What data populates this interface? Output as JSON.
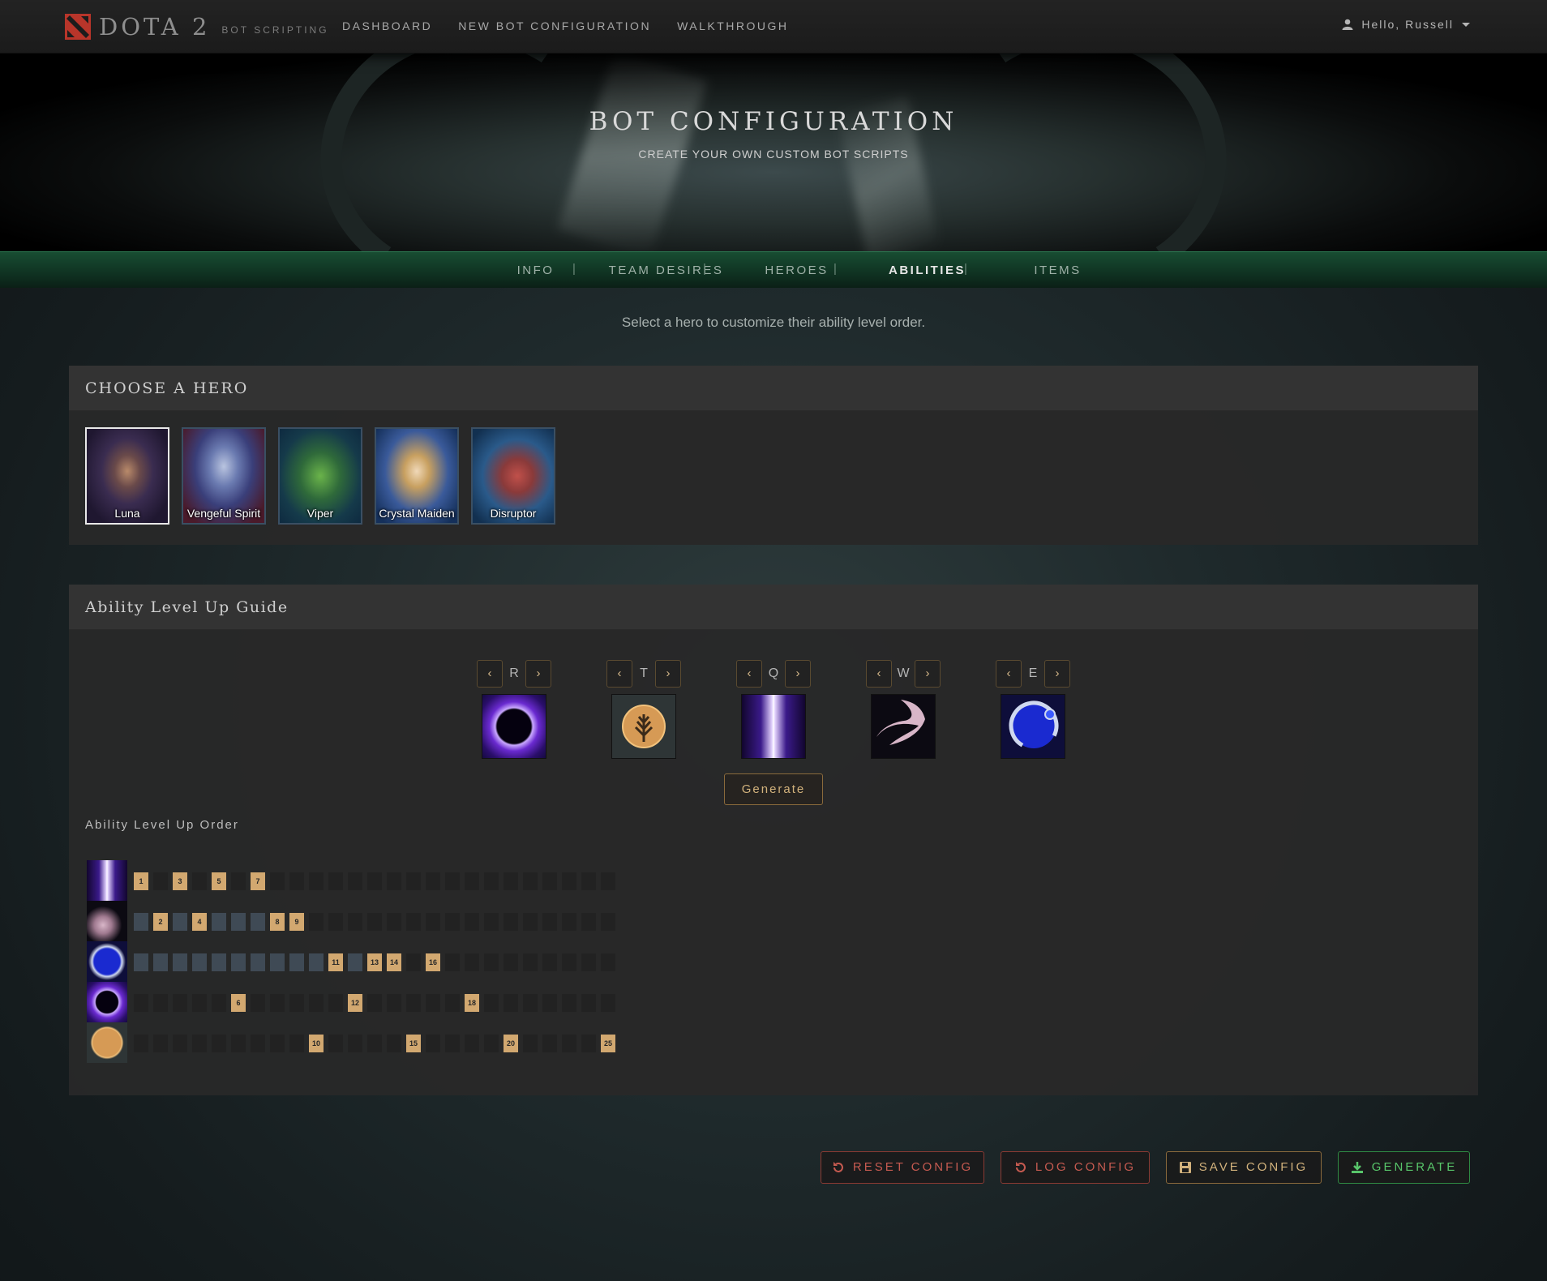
{
  "nav": {
    "logo_title": "DOTA 2",
    "logo_sub": "BOT SCRIPTING",
    "links": [
      "DASHBOARD",
      "NEW BOT CONFIGURATION",
      "WALKTHROUGH"
    ],
    "user": "Hello, Russell"
  },
  "banner": {
    "title": "BOT CONFIGURATION",
    "subtitle": "CREATE YOUR OWN CUSTOM BOT SCRIPTS"
  },
  "tabs": [
    "INFO",
    "TEAM DESIRES",
    "HEROES",
    "ABILITIES",
    "ITEMS"
  ],
  "active_tab": "ABILITIES",
  "intro": "Select a hero to customize their ability level order.",
  "hero_panel": {
    "title": "CHOOSE A HERO",
    "heroes": [
      {
        "name": "Luna",
        "selected": true
      },
      {
        "name": "Vengeful Spirit",
        "selected": false
      },
      {
        "name": "Viper",
        "selected": false
      },
      {
        "name": "Crystal Maiden",
        "selected": false
      },
      {
        "name": "Disruptor",
        "selected": false
      }
    ]
  },
  "ability_panel": {
    "title": "Ability Level Up Guide",
    "priority": [
      {
        "key": "R",
        "icon": "eclipse-icon"
      },
      {
        "key": "T",
        "icon": "talent-tree-icon"
      },
      {
        "key": "Q",
        "icon": "lucent-beam-icon"
      },
      {
        "key": "W",
        "icon": "moon-glaive-icon"
      },
      {
        "key": "E",
        "icon": "lunar-blessing-icon"
      }
    ],
    "generate_label": "Generate",
    "order_title": "Ability Level Up Order",
    "order_rows": [
      {
        "icon": "lucent-beam-icon",
        "levels": [
          1,
          3,
          5,
          7
        ],
        "filled_upto": 0
      },
      {
        "icon": "moon-glaive-icon",
        "levels": [
          2,
          4,
          8,
          9
        ],
        "filled_upto": 7
      },
      {
        "icon": "lunar-blessing-icon",
        "levels": [
          11,
          13,
          14,
          16
        ],
        "filled_upto": 14
      },
      {
        "icon": "eclipse-icon",
        "levels": [
          6,
          12,
          18
        ],
        "filled_upto": 0
      },
      {
        "icon": "talent-tree-icon",
        "levels": [
          10,
          15,
          20,
          25
        ],
        "filled_upto": 0
      }
    ],
    "total_levels": 25
  },
  "buttons": {
    "reset": "RESET CONFIG",
    "log": "LOG CONFIG",
    "save": "SAVE CONFIG",
    "generate": "GENERATE"
  },
  "colors": {
    "accent_gold": "#d2a870",
    "danger": "#c55a50",
    "success": "#58c56a",
    "tab_bar": "#184d32"
  }
}
